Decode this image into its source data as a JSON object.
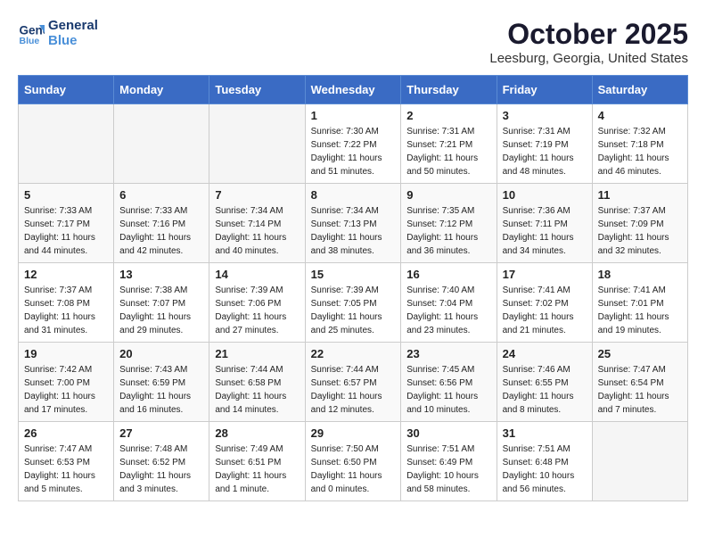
{
  "header": {
    "logo_line1": "General",
    "logo_line2": "Blue",
    "month_title": "October 2025",
    "location": "Leesburg, Georgia, United States"
  },
  "weekdays": [
    "Sunday",
    "Monday",
    "Tuesday",
    "Wednesday",
    "Thursday",
    "Friday",
    "Saturday"
  ],
  "weeks": [
    [
      {
        "day": "",
        "info": ""
      },
      {
        "day": "",
        "info": ""
      },
      {
        "day": "",
        "info": ""
      },
      {
        "day": "1",
        "info": "Sunrise: 7:30 AM\nSunset: 7:22 PM\nDaylight: 11 hours\nand 51 minutes."
      },
      {
        "day": "2",
        "info": "Sunrise: 7:31 AM\nSunset: 7:21 PM\nDaylight: 11 hours\nand 50 minutes."
      },
      {
        "day": "3",
        "info": "Sunrise: 7:31 AM\nSunset: 7:19 PM\nDaylight: 11 hours\nand 48 minutes."
      },
      {
        "day": "4",
        "info": "Sunrise: 7:32 AM\nSunset: 7:18 PM\nDaylight: 11 hours\nand 46 minutes."
      }
    ],
    [
      {
        "day": "5",
        "info": "Sunrise: 7:33 AM\nSunset: 7:17 PM\nDaylight: 11 hours\nand 44 minutes."
      },
      {
        "day": "6",
        "info": "Sunrise: 7:33 AM\nSunset: 7:16 PM\nDaylight: 11 hours\nand 42 minutes."
      },
      {
        "day": "7",
        "info": "Sunrise: 7:34 AM\nSunset: 7:14 PM\nDaylight: 11 hours\nand 40 minutes."
      },
      {
        "day": "8",
        "info": "Sunrise: 7:34 AM\nSunset: 7:13 PM\nDaylight: 11 hours\nand 38 minutes."
      },
      {
        "day": "9",
        "info": "Sunrise: 7:35 AM\nSunset: 7:12 PM\nDaylight: 11 hours\nand 36 minutes."
      },
      {
        "day": "10",
        "info": "Sunrise: 7:36 AM\nSunset: 7:11 PM\nDaylight: 11 hours\nand 34 minutes."
      },
      {
        "day": "11",
        "info": "Sunrise: 7:37 AM\nSunset: 7:09 PM\nDaylight: 11 hours\nand 32 minutes."
      }
    ],
    [
      {
        "day": "12",
        "info": "Sunrise: 7:37 AM\nSunset: 7:08 PM\nDaylight: 11 hours\nand 31 minutes."
      },
      {
        "day": "13",
        "info": "Sunrise: 7:38 AM\nSunset: 7:07 PM\nDaylight: 11 hours\nand 29 minutes."
      },
      {
        "day": "14",
        "info": "Sunrise: 7:39 AM\nSunset: 7:06 PM\nDaylight: 11 hours\nand 27 minutes."
      },
      {
        "day": "15",
        "info": "Sunrise: 7:39 AM\nSunset: 7:05 PM\nDaylight: 11 hours\nand 25 minutes."
      },
      {
        "day": "16",
        "info": "Sunrise: 7:40 AM\nSunset: 7:04 PM\nDaylight: 11 hours\nand 23 minutes."
      },
      {
        "day": "17",
        "info": "Sunrise: 7:41 AM\nSunset: 7:02 PM\nDaylight: 11 hours\nand 21 minutes."
      },
      {
        "day": "18",
        "info": "Sunrise: 7:41 AM\nSunset: 7:01 PM\nDaylight: 11 hours\nand 19 minutes."
      }
    ],
    [
      {
        "day": "19",
        "info": "Sunrise: 7:42 AM\nSunset: 7:00 PM\nDaylight: 11 hours\nand 17 minutes."
      },
      {
        "day": "20",
        "info": "Sunrise: 7:43 AM\nSunset: 6:59 PM\nDaylight: 11 hours\nand 16 minutes."
      },
      {
        "day": "21",
        "info": "Sunrise: 7:44 AM\nSunset: 6:58 PM\nDaylight: 11 hours\nand 14 minutes."
      },
      {
        "day": "22",
        "info": "Sunrise: 7:44 AM\nSunset: 6:57 PM\nDaylight: 11 hours\nand 12 minutes."
      },
      {
        "day": "23",
        "info": "Sunrise: 7:45 AM\nSunset: 6:56 PM\nDaylight: 11 hours\nand 10 minutes."
      },
      {
        "day": "24",
        "info": "Sunrise: 7:46 AM\nSunset: 6:55 PM\nDaylight: 11 hours\nand 8 minutes."
      },
      {
        "day": "25",
        "info": "Sunrise: 7:47 AM\nSunset: 6:54 PM\nDaylight: 11 hours\nand 7 minutes."
      }
    ],
    [
      {
        "day": "26",
        "info": "Sunrise: 7:47 AM\nSunset: 6:53 PM\nDaylight: 11 hours\nand 5 minutes."
      },
      {
        "day": "27",
        "info": "Sunrise: 7:48 AM\nSunset: 6:52 PM\nDaylight: 11 hours\nand 3 minutes."
      },
      {
        "day": "28",
        "info": "Sunrise: 7:49 AM\nSunset: 6:51 PM\nDaylight: 11 hours\nand 1 minute."
      },
      {
        "day": "29",
        "info": "Sunrise: 7:50 AM\nSunset: 6:50 PM\nDaylight: 11 hours\nand 0 minutes."
      },
      {
        "day": "30",
        "info": "Sunrise: 7:51 AM\nSunset: 6:49 PM\nDaylight: 10 hours\nand 58 minutes."
      },
      {
        "day": "31",
        "info": "Sunrise: 7:51 AM\nSunset: 6:48 PM\nDaylight: 10 hours\nand 56 minutes."
      },
      {
        "day": "",
        "info": ""
      }
    ]
  ]
}
